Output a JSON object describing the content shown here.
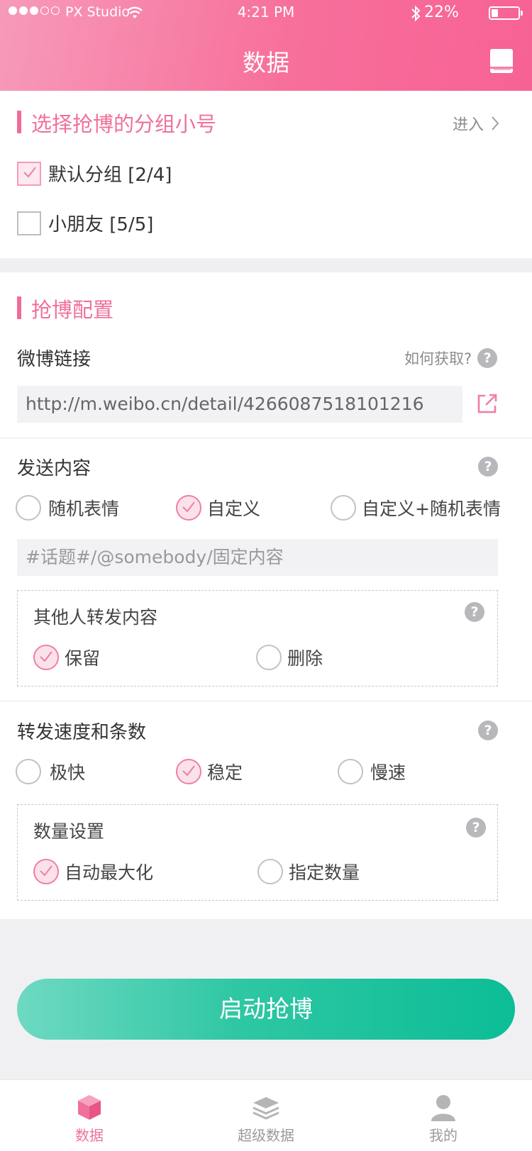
{
  "status_bar": {
    "carrier": "PX Studio",
    "time": "4:21 PM",
    "battery_percent": "22%",
    "battery_level": 0.22,
    "signal_bars_filled": 3,
    "signal_bars_total": 5
  },
  "nav": {
    "title": "数据",
    "right_icon": "book-icon"
  },
  "group_section": {
    "title": "选择抢博的分组小号",
    "enter_label": "进入",
    "groups": [
      {
        "label": "默认分组 [2/4]",
        "checked": true
      },
      {
        "label": "小朋友 [5/5]",
        "checked": false
      }
    ]
  },
  "config_section": {
    "title": "抢博配置",
    "weibo_link": {
      "label": "微博链接",
      "help_label": "如何获取?",
      "value": "http://m.weibo.cn/detail/4266087518101216",
      "open_icon": "external-link-icon"
    },
    "send_content": {
      "label": "发送内容",
      "options": [
        {
          "label": "随机表情",
          "selected": false
        },
        {
          "label": "自定义",
          "selected": true
        },
        {
          "label": "自定义+随机表情",
          "selected": false
        }
      ],
      "placeholder": "#话题#/@somebody/固定内容"
    },
    "others_repost": {
      "label": "其他人转发内容",
      "options": [
        {
          "label": "保留",
          "selected": true
        },
        {
          "label": "删除",
          "selected": false
        }
      ]
    },
    "speed": {
      "label": "转发速度和条数",
      "options": [
        {
          "label": "极快",
          "selected": false
        },
        {
          "label": "稳定",
          "selected": true
        },
        {
          "label": "慢速",
          "selected": false
        }
      ]
    },
    "quantity": {
      "label": "数量设置",
      "options": [
        {
          "label": "自动最大化",
          "selected": true
        },
        {
          "label": "指定数量",
          "selected": false
        }
      ]
    },
    "help_symbol": "?"
  },
  "start_button": {
    "label": "启动抢博"
  },
  "tabbar": {
    "items": [
      {
        "label": "数据",
        "icon": "cube-icon",
        "active": true
      },
      {
        "label": "超级数据",
        "icon": "layers-icon",
        "active": false
      },
      {
        "label": "我的",
        "icon": "user-icon",
        "active": false
      }
    ]
  },
  "colors": {
    "accent_pink": "#ef7199",
    "header_gradient_start": "#f79ab9",
    "header_gradient_end": "#f76294",
    "button_gradient_start": "#6ed9c3",
    "button_gradient_end": "#0bbd96",
    "tab_active": "#ef7199",
    "tab_inactive": "#9a9a9a"
  }
}
